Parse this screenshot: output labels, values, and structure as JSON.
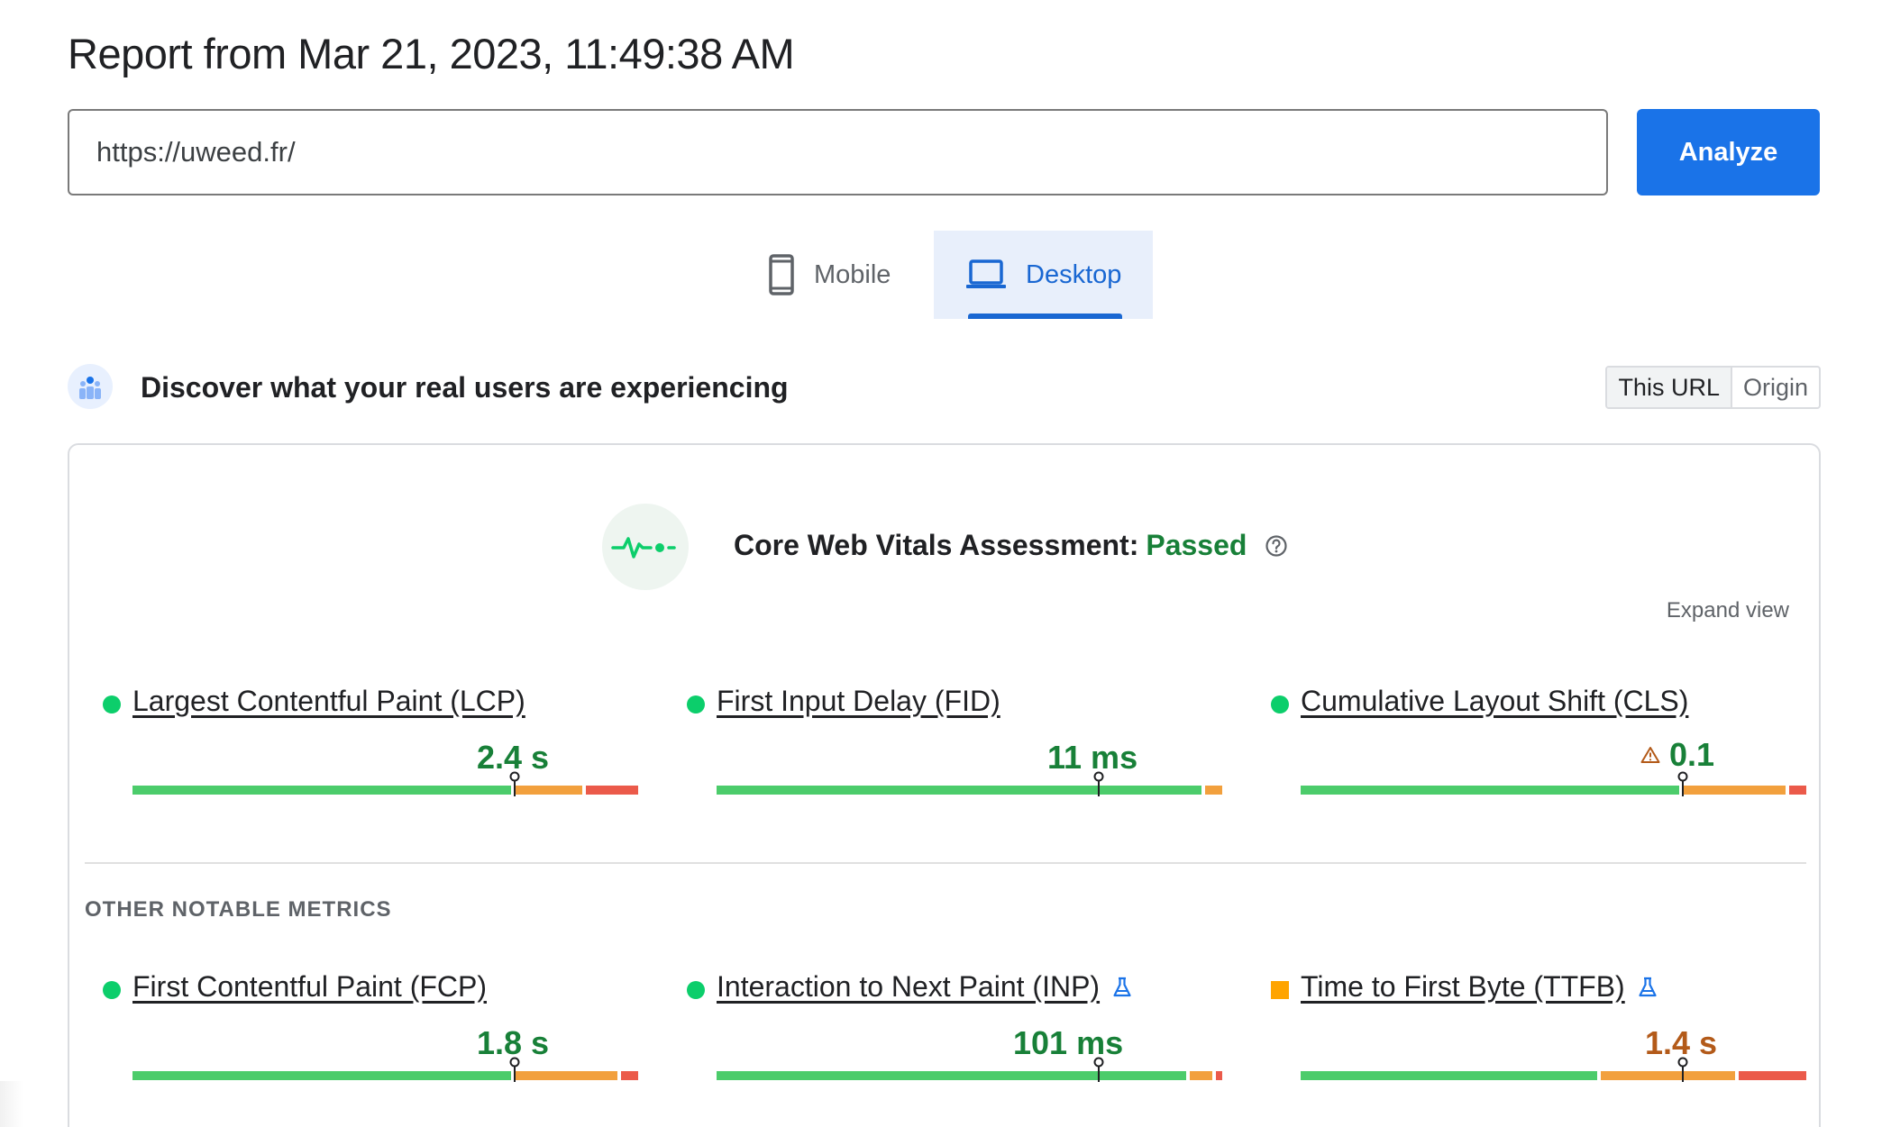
{
  "header": {
    "title": "Report from Mar 21, 2023, 11:49:38 AM"
  },
  "url_bar": {
    "value": "https://uweed.fr/",
    "analyze_label": "Analyze"
  },
  "tabs": [
    {
      "label": "Mobile",
      "icon": "phone-icon",
      "active": false
    },
    {
      "label": "Desktop",
      "icon": "laptop-icon",
      "active": true
    }
  ],
  "discover": {
    "text": "Discover what your real users are experiencing",
    "toggle": [
      "This URL",
      "Origin"
    ],
    "active_toggle": "This URL"
  },
  "assessment": {
    "prefix": "Core Web Vitals Assessment:",
    "status": "Passed",
    "expand_label": "Expand view"
  },
  "core_metrics": [
    {
      "name": "Largest Contentful Paint (LCP)",
      "value": "2.4 s",
      "status": "good",
      "warning": false,
      "distribution": {
        "good": 0.75,
        "needs_improvement": 0.14,
        "poor": 0.11
      },
      "marker": 0.75
    },
    {
      "name": "First Input Delay (FID)",
      "value": "11 ms",
      "status": "good",
      "warning": false,
      "distribution": {
        "good": 0.96,
        "needs_improvement": 0.04,
        "poor": 0.0
      },
      "marker": 0.75
    },
    {
      "name": "Cumulative Layout Shift (CLS)",
      "value": "0.1",
      "status": "good",
      "warning": true,
      "distribution": {
        "good": 0.75,
        "needs_improvement": 0.21,
        "poor": 0.04
      },
      "marker": 0.75
    }
  ],
  "other_heading": "OTHER NOTABLE METRICS",
  "other_metrics": [
    {
      "name": "First Contentful Paint (FCP)",
      "value": "1.8 s",
      "status": "good",
      "experimental": false,
      "distribution": {
        "good": 0.75,
        "needs_improvement": 0.21,
        "poor": 0.04
      },
      "marker": 0.75
    },
    {
      "name": "Interaction to Next Paint (INP)",
      "value": "101 ms",
      "status": "good",
      "experimental": true,
      "distribution": {
        "good": 0.93,
        "needs_improvement": 0.05,
        "poor": 0.02
      },
      "marker": 0.75
    },
    {
      "name": "Time to First Byte (TTFB)",
      "value": "1.4 s",
      "status": "needs-improvement",
      "experimental": true,
      "distribution": {
        "good": 0.59,
        "needs_improvement": 0.27,
        "poor": 0.14
      },
      "marker": 0.75
    }
  ],
  "colors": {
    "good": "#4ccc6b",
    "needs_improvement": "#f2a03d",
    "poor": "#eb5a4a",
    "accent": "#1a73e8",
    "passed_text": "#188038",
    "ni_text": "#b35a19"
  }
}
